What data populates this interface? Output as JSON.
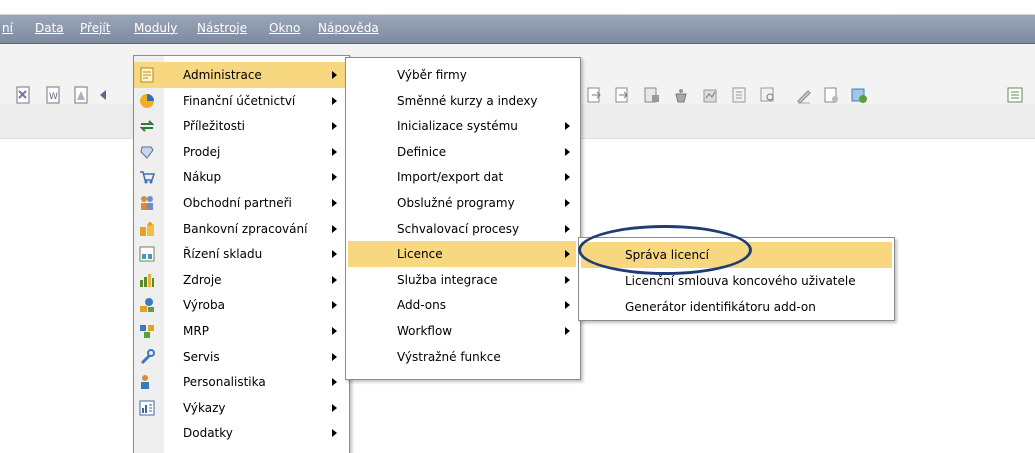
{
  "menubar": [
    "ní",
    "Data",
    "Přejít",
    "Moduly",
    "Nástroje",
    "Okno",
    "Nápověda"
  ],
  "modules_menu": [
    {
      "label": "Administrace",
      "icon": "admin-icon",
      "hl": true,
      "arrow": true
    },
    {
      "label": "Finanční účetnictví",
      "icon": "finance-icon",
      "arrow": true
    },
    {
      "label": "Příležitosti",
      "icon": "opportunities-icon",
      "arrow": true
    },
    {
      "label": "Prodej",
      "icon": "sales-icon",
      "arrow": true
    },
    {
      "label": "Nákup",
      "icon": "cart-icon",
      "arrow": true
    },
    {
      "label": "Obchodní partneři",
      "icon": "partners-icon",
      "arrow": true
    },
    {
      "label": "Bankovní zpracování",
      "icon": "bank-icon",
      "arrow": true
    },
    {
      "label": "Řízení skladu",
      "icon": "warehouse-icon",
      "arrow": true
    },
    {
      "label": "Zdroje",
      "icon": "resources-icon",
      "arrow": true
    },
    {
      "label": "Výroba",
      "icon": "production-icon",
      "arrow": true
    },
    {
      "label": "MRP",
      "icon": "mrp-icon",
      "arrow": true
    },
    {
      "label": "Servis",
      "icon": "service-icon",
      "arrow": true
    },
    {
      "label": "Personalistika",
      "icon": "hr-icon",
      "arrow": true
    },
    {
      "label": "Výkazy",
      "icon": "reports-icon",
      "arrow": true
    },
    {
      "label": "Dodatky",
      "icon": "",
      "arrow": true
    }
  ],
  "admin_menu": [
    {
      "label": "Výběr firmy",
      "arrow": false
    },
    {
      "label": "Směnné kurzy a indexy",
      "arrow": false
    },
    {
      "label": "Inicializace systému",
      "arrow": true
    },
    {
      "label": "Definice",
      "arrow": true
    },
    {
      "label": "Import/export dat",
      "arrow": true
    },
    {
      "label": "Obslužné programy",
      "arrow": true
    },
    {
      "label": "Schvalovací procesy",
      "arrow": true
    },
    {
      "label": "Licence",
      "arrow": true,
      "hl": true
    },
    {
      "label": "Služba integrace",
      "arrow": true
    },
    {
      "label": "Add-ons",
      "arrow": true
    },
    {
      "label": "Workflow",
      "arrow": true
    },
    {
      "label": "Výstražné funkce",
      "arrow": false
    }
  ],
  "licence_menu": [
    {
      "label": "Správa licencí",
      "hl": true
    },
    {
      "label": "Licenční smlouva koncového uživatele"
    },
    {
      "label": "Generátor identifikátoru add-on"
    }
  ],
  "colors": {
    "highlight": "#f7d77f",
    "menubar": "#8793a8",
    "ellipse": "#1f3c73"
  }
}
